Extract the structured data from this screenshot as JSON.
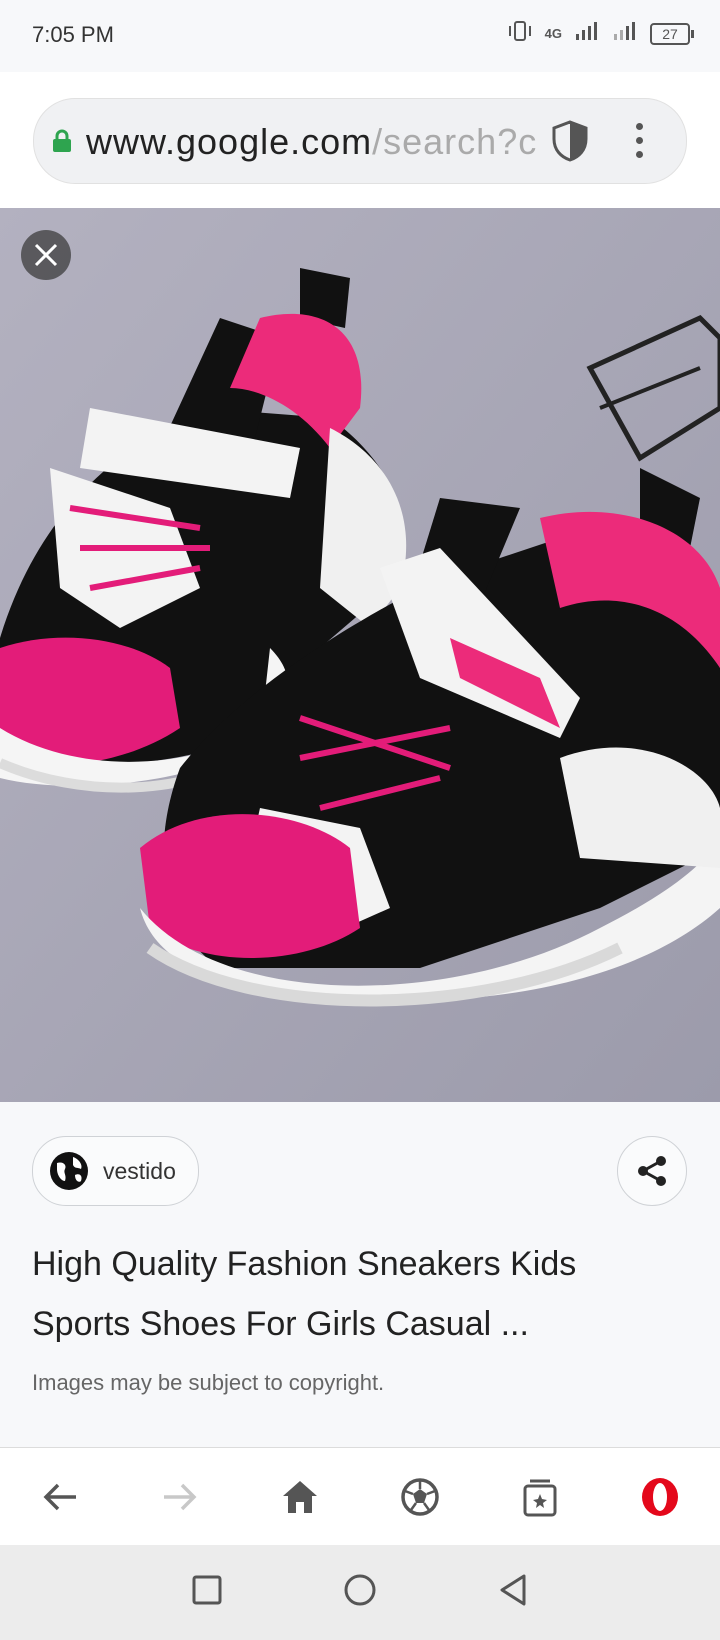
{
  "status_bar": {
    "time": "7:05 PM",
    "network": "4G",
    "battery": "27"
  },
  "browser": {
    "url_domain": "www.google.com",
    "url_path": "/search?c"
  },
  "image_viewer": {
    "image_description_icon": "sneaker-photo",
    "source_name": "vestido",
    "title": "High Quality Fashion Sneakers Kids Sports Shoes For Girls Casual ...",
    "copyright": "Images may be subject to copyright."
  },
  "colors": {
    "accent_red": "#e4081b",
    "lock_green": "#2ea44f",
    "shoe_pink": "#ec2b7a"
  }
}
